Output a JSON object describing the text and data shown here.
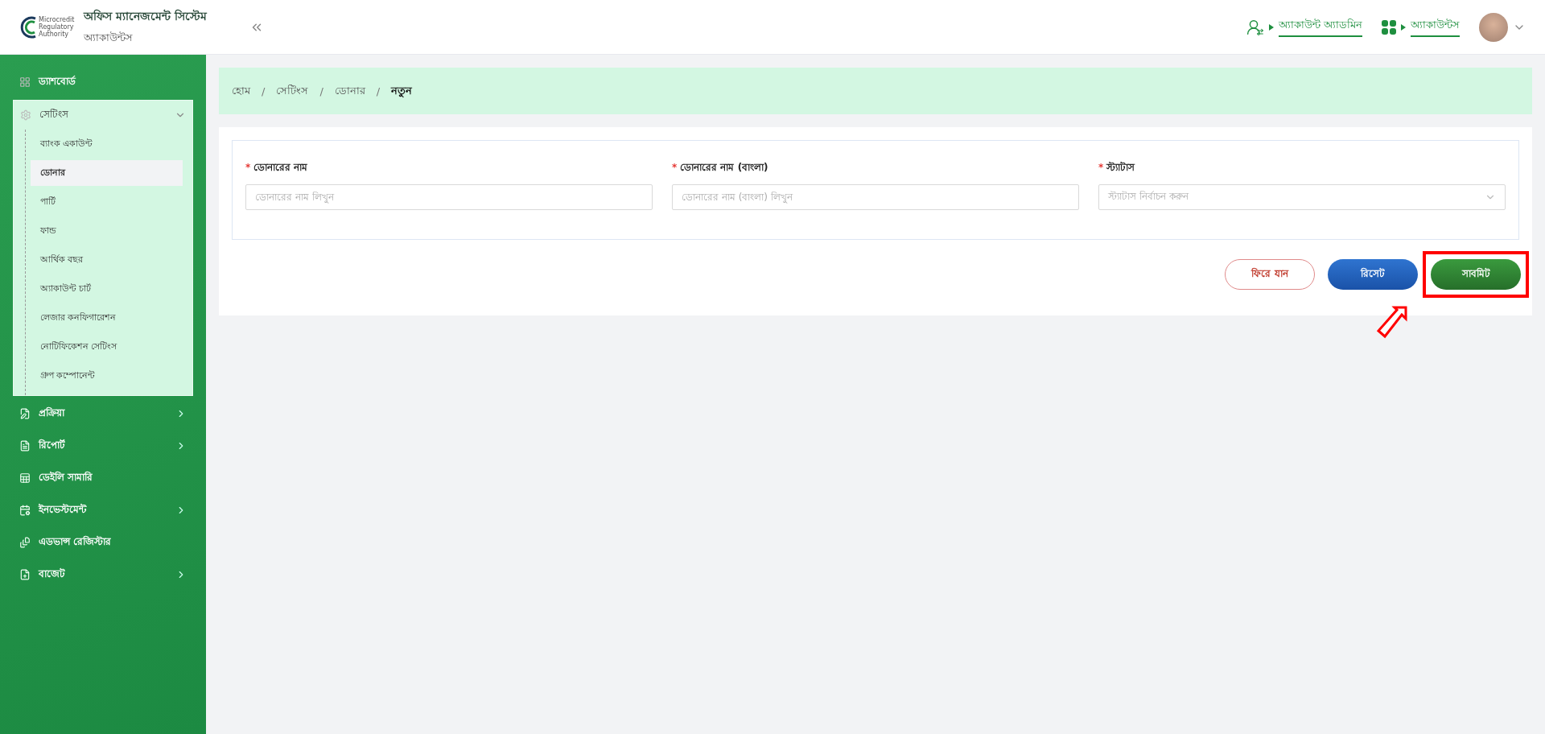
{
  "header": {
    "logo_lines": [
      "Microcredit",
      "Regulatory",
      "Authority"
    ],
    "app_title": "অফিস ম্যানেজমেন্ট সিস্টেম",
    "app_subtitle": "অ্যাকাউন্টস",
    "links": [
      {
        "kind": "role",
        "label": "অ্যাকাউন্ট অ্যাডমিন"
      },
      {
        "kind": "module",
        "label": "অ্যাকাউন্টস"
      }
    ]
  },
  "sidebar": {
    "items": [
      {
        "label": "ড্যাশবোর্ড"
      },
      {
        "label": "সেটিংস",
        "expanded": true,
        "children": [
          {
            "label": "ব্যাংক একাউন্ট",
            "selected": false
          },
          {
            "label": "ডোনার",
            "selected": true
          },
          {
            "label": "পার্টি",
            "selected": false
          },
          {
            "label": "ফান্ড",
            "selected": false
          },
          {
            "label": "আর্থিক বছর",
            "selected": false
          },
          {
            "label": "অ্যাকাউন্ট চার্ট",
            "selected": false
          },
          {
            "label": "লেজার কনফিগারেশন",
            "selected": false
          },
          {
            "label": "নোটিফিকেশন সেটিংস",
            "selected": false
          },
          {
            "label": "গ্রুপ কম্পোনেন্ট",
            "selected": false
          }
        ]
      },
      {
        "label": "প্রক্রিয়া",
        "expanded": false
      },
      {
        "label": "রিপোর্ট",
        "expanded": false
      },
      {
        "label": "ডেইলি সামারি"
      },
      {
        "label": "ইনভেস্টমেন্ট",
        "expanded": false
      },
      {
        "label": "এডভান্স রেজিস্টার"
      },
      {
        "label": "বাজেট",
        "expanded": false
      }
    ]
  },
  "breadcrumb": [
    "হোম",
    "সেটিংস",
    "ডোনার",
    "নতুন"
  ],
  "breadcrumb_separator": "/",
  "form": {
    "fields": [
      {
        "kind": "input",
        "required_mark": "*",
        "label": "ডোনারের নাম",
        "placeholder": "ডোনারের নাম লিখুন"
      },
      {
        "kind": "input",
        "required_mark": "*",
        "label": "ডোনারের নাম (বাংলা)",
        "placeholder": "ডোনারের নাম (বাংলা) লিখুন"
      },
      {
        "kind": "select",
        "required_mark": "*",
        "label": "স্ট্যাটাস",
        "placeholder": "স্ট্যাটাস নির্বাচন করুন"
      }
    ],
    "buttons": [
      {
        "kind": "back",
        "label": "ফিরে যান",
        "highlighted": false
      },
      {
        "kind": "reset",
        "label": "রিসেট",
        "highlighted": false
      },
      {
        "kind": "submit",
        "label": "সাবমিট",
        "highlighted": true
      }
    ]
  }
}
